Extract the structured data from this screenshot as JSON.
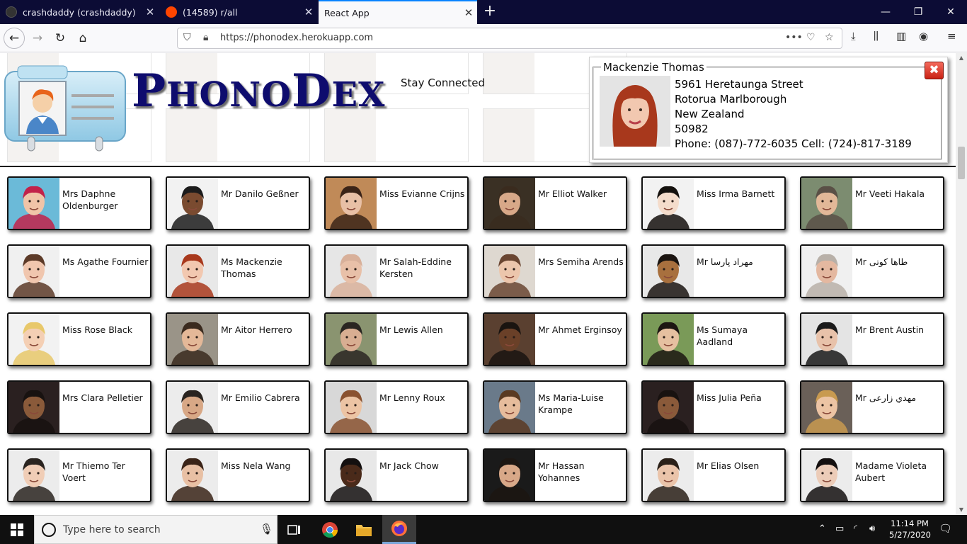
{
  "browser": {
    "tabs": [
      {
        "title": "crashdaddy (crashdaddy)",
        "active": false,
        "favicon_color": "#333333"
      },
      {
        "title": "(14589) r/all",
        "active": false,
        "favicon_color": "#ff4500"
      },
      {
        "title": "React App",
        "active": true,
        "favicon_color": ""
      }
    ],
    "url": "https://phonodex.herokuapp.com",
    "accent": "#0a84ff"
  },
  "header": {
    "logo_first_letter_1": "P",
    "logo_rest_1": "HONO",
    "logo_first_letter_2": "D",
    "logo_rest_2": "EX",
    "tagline": "Stay Connected"
  },
  "detail": {
    "name": "Mackenzie Thomas",
    "street": "5961 Heretaunga Street",
    "city_line": "Rotorua Marlborough",
    "country": "New Zealand",
    "postcode": "50982",
    "phone_line": "Phone: (087)-772-6035 Cell: (724)-817-3189",
    "close_label": "✖"
  },
  "contacts": [
    {
      "name": "Mrs Daphne Oldenburger",
      "hair": "#c2224a",
      "skin": "#f0c4a8",
      "bg": "#6bbad8"
    },
    {
      "name": "Mr Danilo Geßner",
      "hair": "#1c1c1c",
      "skin": "#7a4b30",
      "bg": "#f2f2f2"
    },
    {
      "name": "Miss Evianne Crijns",
      "hair": "#3b2418",
      "skin": "#e8c0a6",
      "bg": "#c08a58"
    },
    {
      "name": "Mr Elliot Walker",
      "hair": "#3a2b1e",
      "skin": "#d8a888",
      "bg": "#3a3024"
    },
    {
      "name": "Miss Irma Barnett",
      "hair": "#15110e",
      "skin": "#f4dccb",
      "bg": "#f2f2f2"
    },
    {
      "name": "Mr Veeti Hakala",
      "hair": "#5a5046",
      "skin": "#e2b898",
      "bg": "#7c8c70"
    },
    {
      "name": "Ms Agathe Fournier",
      "hair": "#5c3a28",
      "skin": "#f0c6ae",
      "bg": "#f0f0f0"
    },
    {
      "name": "Ms Mackenzie Thomas",
      "hair": "#a8381c",
      "skin": "#f2c8b0",
      "bg": "#e8e8e8"
    },
    {
      "name": "Mr Salah-Eddine Kersten",
      "hair": "#d8b09a",
      "skin": "#e8c0a8",
      "bg": "#e6e6e6"
    },
    {
      "name": "Mrs Semiha Arends",
      "hair": "#6a4632",
      "skin": "#ecc6ac",
      "bg": "#ded8d0"
    },
    {
      "name": "Mr مهراد پارسا",
      "hair": "#1a1410",
      "skin": "#a8703e",
      "bg": "#e8e8e8"
    },
    {
      "name": "Mr طاها کوتی",
      "hair": "#b8b0a8",
      "skin": "#e4b8a0",
      "bg": "#f0f0f0"
    },
    {
      "name": "Miss Rose Black",
      "hair": "#e8c86a",
      "skin": "#f4cfb4",
      "bg": "#f2f2f2"
    },
    {
      "name": "Mr Aitor Herrero",
      "hair": "#3a2a1e",
      "skin": "#e4b898",
      "bg": "#9a9488"
    },
    {
      "name": "Mr Lewis Allen",
      "hair": "#2a2622",
      "skin": "#d8ae92",
      "bg": "#8a9470"
    },
    {
      "name": "Mr Ahmet Erginsoy",
      "hair": "#1a1410",
      "skin": "#6a4028",
      "bg": "#5a4030"
    },
    {
      "name": "Ms Sumaya Aadland",
      "hair": "#1c1612",
      "skin": "#e6c0a0",
      "bg": "#7a9a58"
    },
    {
      "name": "Mr Brent Austin",
      "hair": "#1a1a1a",
      "skin": "#e8c2aa",
      "bg": "#e4e4e4"
    },
    {
      "name": "Mrs Clara Pelletier",
      "hair": "#181210",
      "skin": "#8a5a3a",
      "bg": "#2a2020"
    },
    {
      "name": "Mr Emilio Cabrera",
      "hair": "#2a2420",
      "skin": "#d8a886",
      "bg": "#ececec"
    },
    {
      "name": "Mr Lenny Roux",
      "hair": "#8a5230",
      "skin": "#ecc4a4",
      "bg": "#d8d8d8"
    },
    {
      "name": "Ms Maria-Luise Krampe",
      "hair": "#5a3a22",
      "skin": "#e6bc9c",
      "bg": "#6a7a8a"
    },
    {
      "name": "Miss Julia Peña",
      "hair": "#181210",
      "skin": "#8a5a3a",
      "bg": "#2a2020"
    },
    {
      "name": "Mr مهدي زارعی",
      "hair": "#c89a50",
      "skin": "#ecc4a4",
      "bg": "#6a6058"
    },
    {
      "name": "Mr Thiemo Ter Voert",
      "hair": "#2a2420",
      "skin": "#f0cdb6",
      "bg": "#ececec"
    },
    {
      "name": "Miss Nela Wang",
      "hair": "#3a2418",
      "skin": "#e8c0a4",
      "bg": "#ececec"
    },
    {
      "name": "Mr Jack Chow",
      "hair": "#141010",
      "skin": "#4a2a1a",
      "bg": "#e8e8e8"
    },
    {
      "name": "Mr Hassan Yohannes",
      "hair": "#1c1612",
      "skin": "#d8a888",
      "bg": "#1a1a1a"
    },
    {
      "name": "Mr Elias Olsen",
      "hair": "#2a2018",
      "skin": "#eac4aa",
      "bg": "#ececec"
    },
    {
      "name": "Madame Violeta Aubert",
      "hair": "#141010",
      "skin": "#ecccb8",
      "bg": "#ececec"
    }
  ],
  "taskbar": {
    "search_placeholder": "Type here to search",
    "time": "11:14 PM",
    "date": "5/27/2020"
  }
}
